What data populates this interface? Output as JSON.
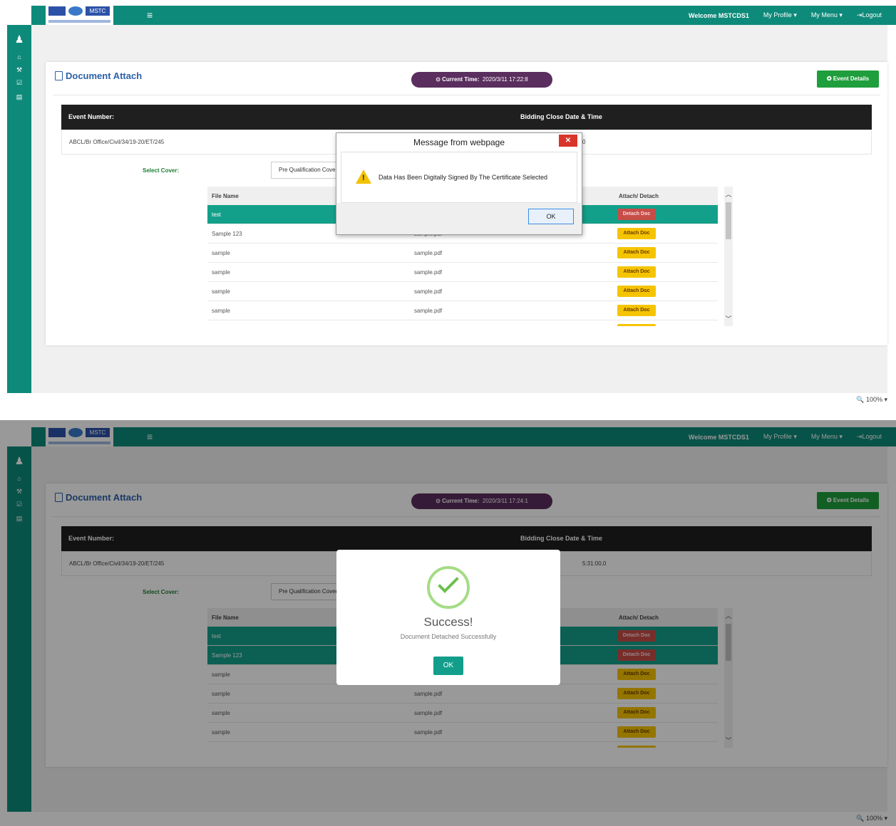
{
  "header": {
    "logo_left": "MSTC",
    "logo_right": "MSTC",
    "welcome": "Welcome MSTCDS1",
    "menu_profile": "My Profile ▾",
    "menu_main": "My Menu ▾",
    "logout": "⇥Logout"
  },
  "page": {
    "title": "Document Attach",
    "event_details_button": "✪ Event Details"
  },
  "event_table": {
    "headers": [
      "Event Number:",
      "Bidding Close Date & Time"
    ],
    "event_number": "ABCL/Br Office/Civil/34/19-20/ET/245",
    "close_date_partial_1": "0",
    "close_date_partial_2": "5:31:00.0"
  },
  "cover": {
    "label": "Select Cover:",
    "value": "Pre Qualification Cover"
  },
  "file_table": {
    "headers": [
      "File Name",
      "",
      "Attach/ Detach"
    ]
  },
  "screen1": {
    "time_label": "⊙ Current Time:",
    "time_value": "2020/3/11 17:22:8",
    "rows": [
      {
        "name": "test",
        "doc": "",
        "action": "Detach Doc"
      },
      {
        "name": "Sample 123",
        "doc": "sample.pdf",
        "action": "Attach Doc"
      },
      {
        "name": "sample",
        "doc": "sample.pdf",
        "action": "Attach Doc"
      },
      {
        "name": "sample",
        "doc": "sample.pdf",
        "action": "Attach Doc"
      },
      {
        "name": "sample",
        "doc": "sample.pdf",
        "action": "Attach Doc"
      },
      {
        "name": "sample",
        "doc": "sample.pdf",
        "action": "Attach Doc"
      },
      {
        "name": "",
        "doc": "",
        "action": "Attach Doc"
      }
    ],
    "dialog": {
      "title": "Message from webpage",
      "message": "Data Has Been Digitally Signed By The Certificate Selected",
      "ok": "OK",
      "close": "✕"
    }
  },
  "screen2": {
    "time_label": "⊙ Current Time:",
    "time_value": "2020/3/11 17:24:1",
    "rows": [
      {
        "name": "test",
        "doc": "",
        "action": "Detach Doc"
      },
      {
        "name": "Sample 123",
        "doc": "",
        "action": "Detach Doc"
      },
      {
        "name": "sample",
        "doc": "",
        "action": "Attach Doc"
      },
      {
        "name": "sample",
        "doc": "sample.pdf",
        "action": "Attach Doc"
      },
      {
        "name": "sample",
        "doc": "sample.pdf",
        "action": "Attach Doc"
      },
      {
        "name": "sample",
        "doc": "sample.pdf",
        "action": "Attach Doc"
      },
      {
        "name": "",
        "doc": "",
        "action": "Attach Doc"
      }
    ],
    "dialog": {
      "title": "Success!",
      "message": "Document Detached Successfully",
      "ok": "OK"
    }
  },
  "statusbar": {
    "zoom": "🔍 100%  ▾"
  },
  "colors": {
    "brand_teal": "#0e8a7a",
    "selected_row": "#13a08a",
    "attach_yellow": "#f5c400",
    "detach_red": "#c74d48",
    "time_pill": "#5a2e5e",
    "event_button_green": "#1e9e3c"
  }
}
